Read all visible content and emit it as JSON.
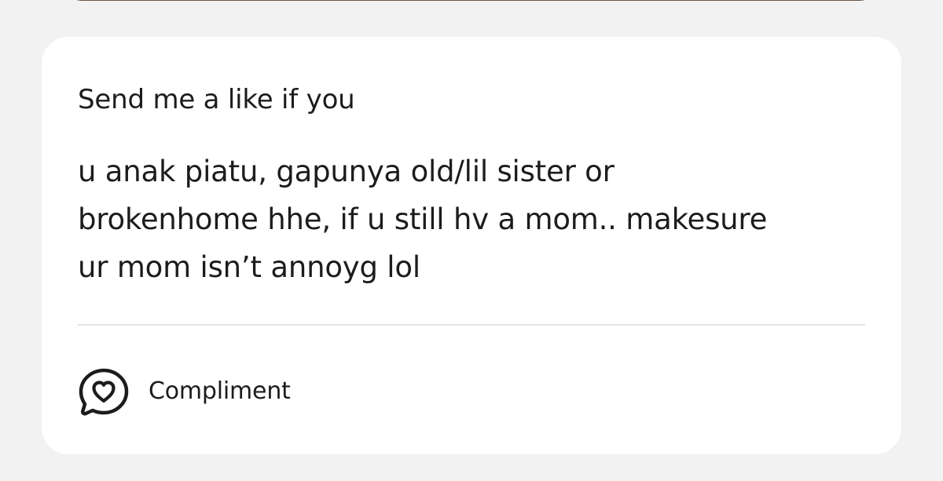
{
  "prompt_card": {
    "title": "Send me a like if you",
    "answer_lines": [
      "u anak piatu, gapunya old/lil sister or",
      "brokenhome hhe, if u still hv a mom.. makesure",
      "ur mom isn’t annoyg lol"
    ]
  },
  "actions": {
    "compliment_label": "Compliment",
    "compliment_icon": "heart-speech-bubble-icon"
  },
  "colors": {
    "background": "#f2f2f2",
    "card": "#ffffff",
    "text": "#1c1c1c",
    "divider": "#e3e3e3"
  }
}
